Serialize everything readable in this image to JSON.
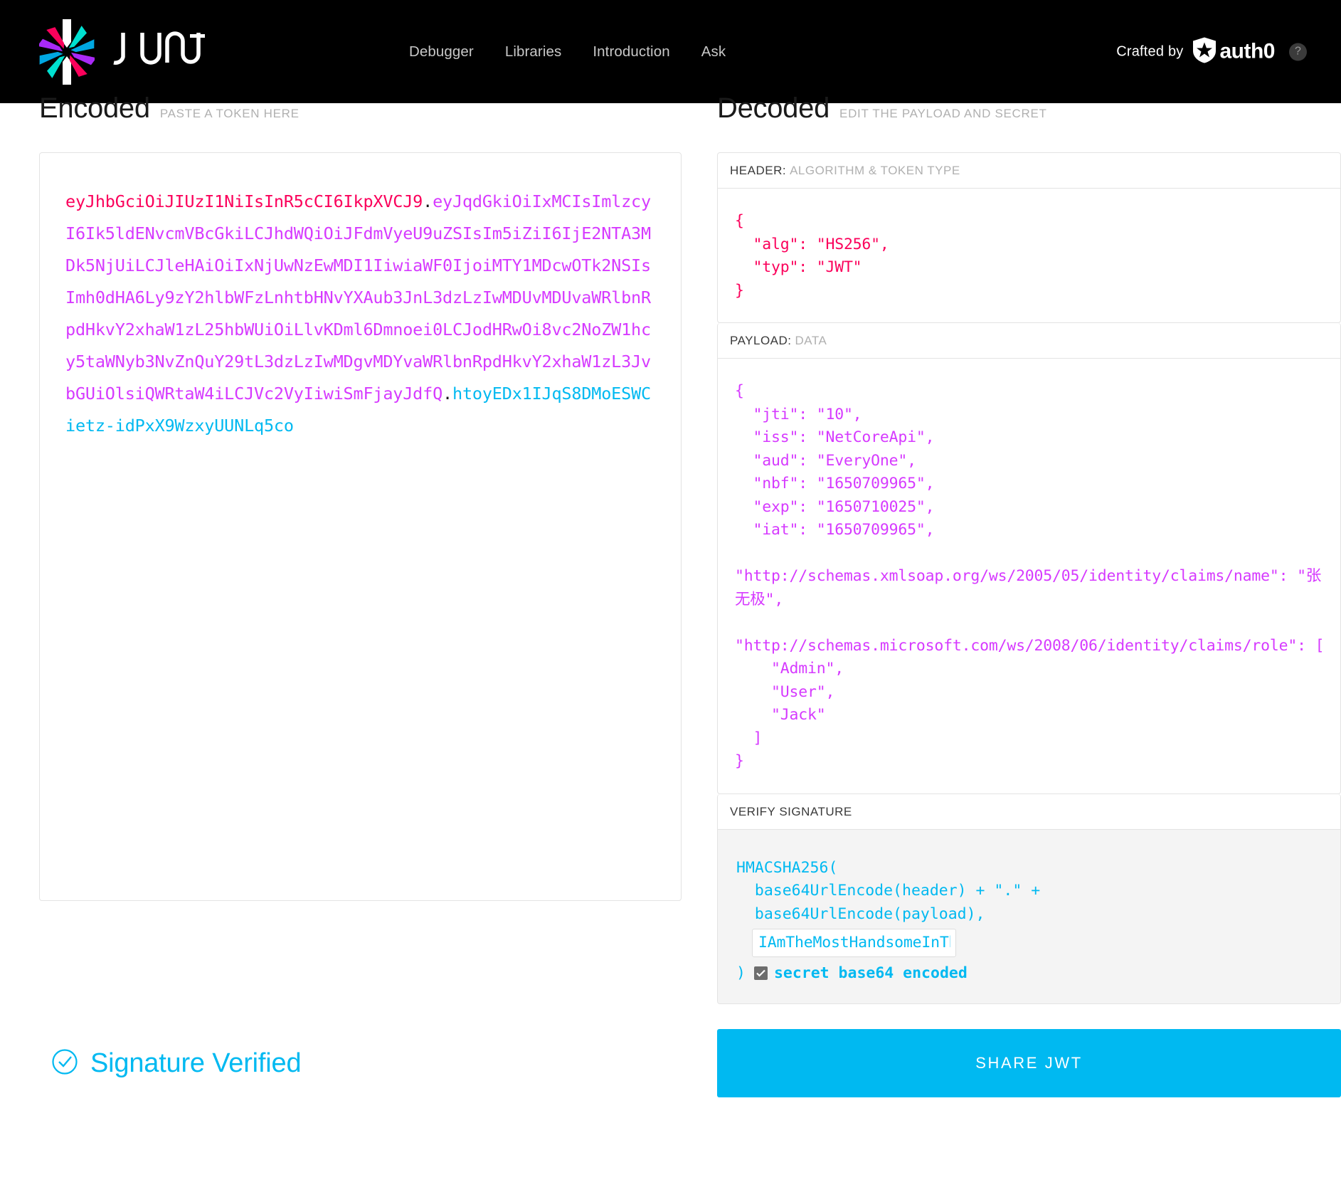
{
  "nav": {
    "logo_alt": "JWT",
    "brand_word": "JWT",
    "links": [
      {
        "label": "Debugger"
      },
      {
        "label": "Libraries"
      },
      {
        "label": "Introduction"
      },
      {
        "label": "Ask"
      }
    ],
    "crafted_by": "Crafted by",
    "auth0_word": "auth0",
    "help_glyph": "?"
  },
  "encoded": {
    "title": "Encoded",
    "subtitle": "PASTE A TOKEN HERE",
    "token_header": "eyJhbGciOiJIUzI1NiIsInR5cCI6IkpXVCJ9",
    "dot1": ".",
    "token_payload": "eyJqdGkiOiIxMCIsImlzcyI6Ik5ldENvcmVBcGkiLCJhdWQiOiJFdmVyeU9uZSIsIm5iZiI6IjE2NTA3MDk5NjUiLCJleHAiOiIxNjUwNzEwMDI1IiwiaWF0IjoiMTY1MDcwOTk2NSIsImh0dHA6Ly9zY2hlbWFzLnhtbHNvYXAub3JnL3dzLzIwMDUvMDUvaWRlbnRpdHkvY2xhaW1zL25hbWUiOiLlvKDml6Dmnoei0LCJodHRwOi8vc2NoZW1hcy5taWNyb3NvZnQuY29tL3dzLzIwMDgvMDYvaWRlbnRpdHkvY2xhaW1zL3JvbGUiOlsiQWRtaW4iLCJVc2VyIiwiSmFjayJdfQ",
    "dot2": ".",
    "token_signature": "htoyEDx1IJqS8DMoESWCietz-idPxX9WzxyUUNLq5co"
  },
  "decoded": {
    "title": "Decoded",
    "subtitle": "EDIT THE PAYLOAD AND SECRET",
    "header_panel": {
      "label": "HEADER:",
      "sub": "ALGORITHM & TOKEN TYPE",
      "json": "{\n  \"alg\": \"HS256\",\n  \"typ\": \"JWT\"\n}"
    },
    "payload_panel": {
      "label": "PAYLOAD:",
      "sub": "DATA",
      "json": "{\n  \"jti\": \"10\",\n  \"iss\": \"NetCoreApi\",\n  \"aud\": \"EveryOne\",\n  \"nbf\": \"1650709965\",\n  \"exp\": \"1650710025\",\n  \"iat\": \"1650709965\",\n\n\"http://schemas.xmlsoap.org/ws/2005/05/identity/claims/name\": \"张无极\",\n\n\"http://schemas.microsoft.com/ws/2008/06/identity/claims/role\": [\n    \"Admin\",\n    \"User\",\n    \"Jack\"\n  ]\n}"
    },
    "signature_panel": {
      "label": "VERIFY SIGNATURE",
      "line1": "HMACSHA256(",
      "line2": "  base64UrlEncode(header) + \".\" +",
      "line3": "  base64UrlEncode(payload),",
      "secret_value": "IAmTheMostHandsomeInTh",
      "closing_paren": ")",
      "secret_checkbox_label": "secret base64 encoded",
      "secret_checkbox_checked": true
    }
  },
  "footer": {
    "verified_text": "Signature Verified",
    "share_label": "SHARE JWT"
  },
  "colors": {
    "header_red": "#fb015b",
    "payload_magenta": "#d63aff",
    "signature_cyan": "#00b9f1",
    "nav_background": "#000000",
    "accent_button": "#00b9f1"
  }
}
